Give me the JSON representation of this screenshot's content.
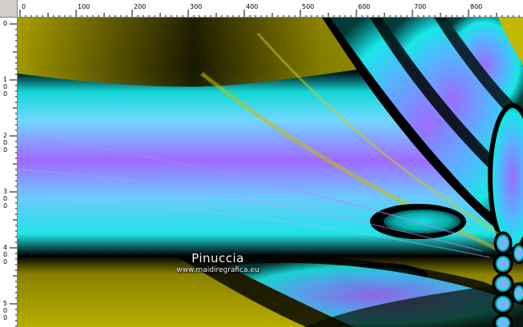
{
  "ruler": {
    "horizontal_labels": [
      "0",
      "100",
      "200",
      "300",
      "400",
      "500",
      "600",
      "700",
      "800"
    ],
    "vertical_labels": [
      "0",
      "100",
      "200",
      "300",
      "400",
      "500"
    ]
  },
  "canvas": {
    "image_description": "fractal abstract",
    "colors": {
      "olive": "#a8a000",
      "cyan": "#18e6e6",
      "violet": "#9b6cff",
      "black": "#000000"
    }
  },
  "watermark": {
    "title": "Pinuccia",
    "url": "www.maidiregrafica.eu"
  }
}
